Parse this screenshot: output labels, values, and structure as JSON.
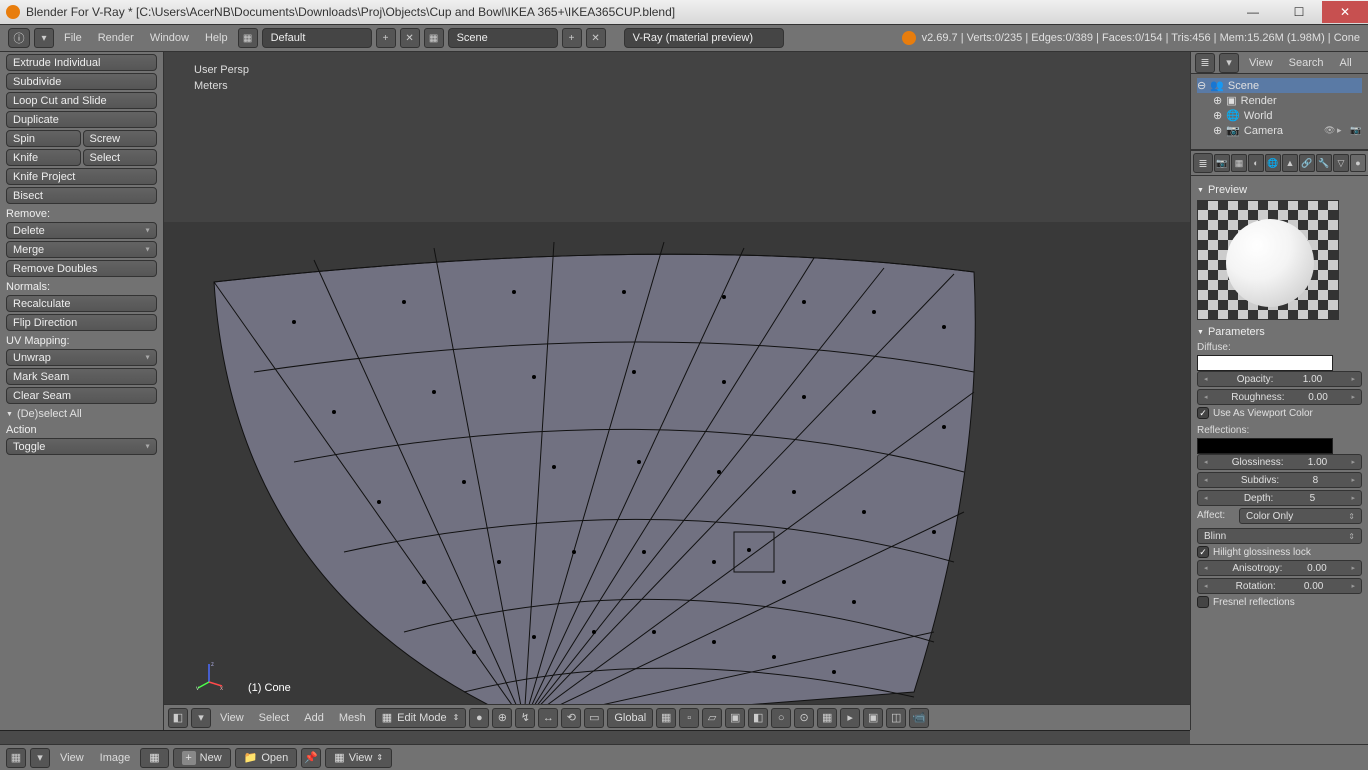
{
  "title": "Blender For V-Ray * [C:\\Users\\AcerNB\\Documents\\Downloads\\Proj\\Objects\\Cup and Bowl\\IKEA 365+\\IKEA365CUP.blend]",
  "topmenu": {
    "file": "File",
    "render": "Render",
    "window": "Window",
    "help": "Help"
  },
  "layout_picker": "Default",
  "scene_picker": "Scene",
  "engine_picker": "V-Ray (material preview)",
  "stats": "v2.69.7 | Verts:0/235 | Edges:0/389 | Faces:0/154 | Tris:456 | Mem:15.26M (1.98M) | Cone",
  "toolshelf": {
    "extrude_individual": "Extrude Individual",
    "subdivide": "Subdivide",
    "loop_cut": "Loop Cut and Slide",
    "duplicate": "Duplicate",
    "spin": "Spin",
    "screw": "Screw",
    "knife": "Knife",
    "select_knife": "Select",
    "knife_project": "Knife Project",
    "bisect": "Bisect",
    "remove_label": "Remove:",
    "delete": "Delete",
    "merge": "Merge",
    "remove_doubles": "Remove Doubles",
    "normals_label": "Normals:",
    "recalc": "Recalculate",
    "flip": "Flip Direction",
    "uv_label": "UV Mapping:",
    "unwrap": "Unwrap",
    "mark_seam": "Mark Seam",
    "clear_seam": "Clear Seam",
    "redo_panel": "(De)select All",
    "action_label": "Action",
    "toggle": "Toggle"
  },
  "view3d": {
    "persp": "User Persp",
    "units": "Meters",
    "obj": "(1) Cone",
    "header_view": "View",
    "header_select": "Select",
    "header_add": "Add",
    "header_mesh": "Mesh",
    "mode": "Edit Mode",
    "orient": "Global"
  },
  "outliner": {
    "view": "View",
    "search": "Search",
    "all": "All",
    "scene": "Scene",
    "render": "Render",
    "world": "World",
    "camera": "Camera"
  },
  "mat": {
    "preview": "Preview",
    "parameters": "Parameters",
    "diffuse": "Diffuse:",
    "opacity_l": "Opacity:",
    "opacity_v": "1.00",
    "rough_l": "Roughness:",
    "rough_v": "0.00",
    "use_vc": "Use As Viewport Color",
    "reflections": "Reflections:",
    "gloss_l": "Glossiness:",
    "gloss_v": "1.00",
    "subdivs_l": "Subdivs:",
    "subdivs_v": "8",
    "depth_l": "Depth:",
    "depth_v": "5",
    "affect_l": "Affect:",
    "affect_v": "Color Only",
    "brdf": "Blinn",
    "hilight": "Hilight glossiness lock",
    "aniso_l": "Anisotropy:",
    "aniso_v": "0.00",
    "rot_l": "Rotation:",
    "rot_v": "0.00",
    "fresnel": "Fresnel reflections"
  },
  "uv": {
    "view": "View",
    "image": "Image",
    "new": "New",
    "open": "Open",
    "view2": "View"
  }
}
